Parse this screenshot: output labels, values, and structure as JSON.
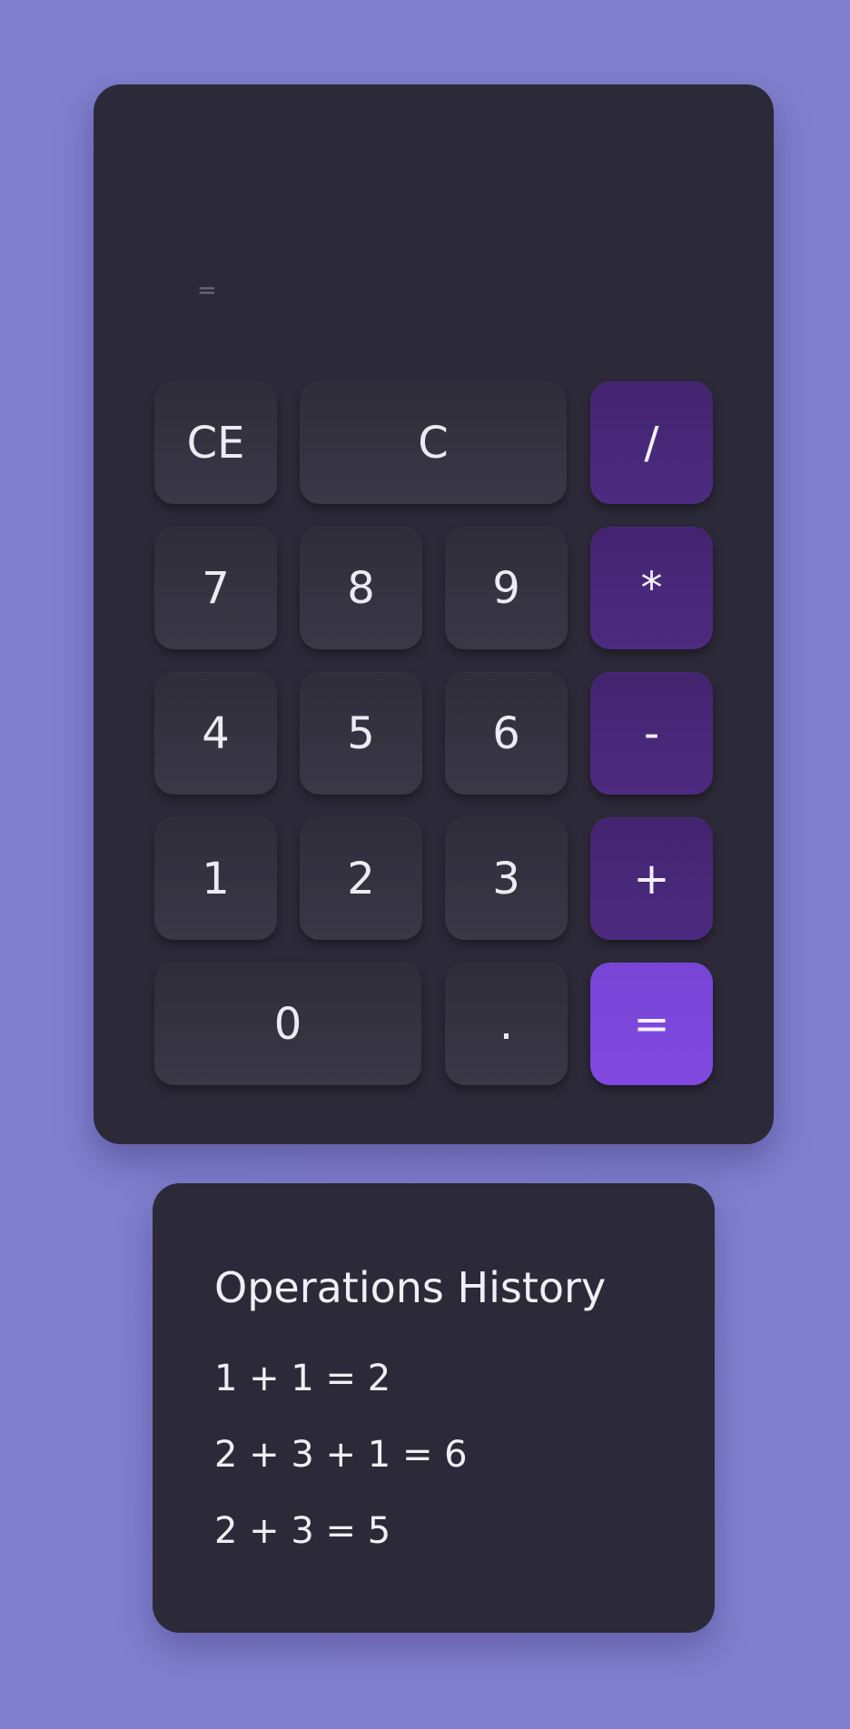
{
  "display": {
    "current_value": "",
    "expression": "="
  },
  "buttons": {
    "ce": "CE",
    "c": "C",
    "divide": "/",
    "seven": "7",
    "eight": "8",
    "nine": "9",
    "multiply": "*",
    "four": "4",
    "five": "5",
    "six": "6",
    "subtract": "-",
    "one": "1",
    "two": "2",
    "three": "3",
    "add": "+",
    "zero": "0",
    "decimal": ".",
    "equals": "="
  },
  "history": {
    "title": "Operations History",
    "items": [
      "1 + 1 = 2",
      "2 + 3 + 1 = 6",
      "2 + 3 = 5"
    ]
  },
  "colors": {
    "background": "#7f7fcd",
    "panel": "#2c2a38",
    "button": "#34323f",
    "operator": "#4a2a7c",
    "equals": "#7b47dc"
  }
}
